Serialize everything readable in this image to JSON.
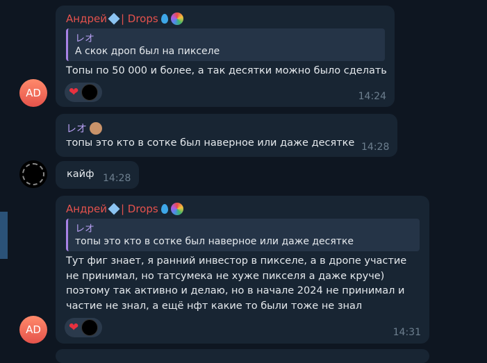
{
  "messages": [
    {
      "sender": "Андрей",
      "sender_suffix": "| Drops",
      "reply_name": "レオ",
      "reply_text": "А скок дроп был на пикселе",
      "text": "Топы по 50 000 и более, а так десятки можно было сделать",
      "time": "14:24",
      "avatar": "AD",
      "reaction": "❤"
    },
    {
      "sender": "レオ",
      "text": "топы это кто в сотке был наверное или даже десятке",
      "time": "14:28"
    },
    {
      "text": "кайф",
      "time": "14:28"
    },
    {
      "sender": "Андрей",
      "sender_suffix": "| Drops",
      "reply_name": "レオ",
      "reply_text": "топы это кто в сотке был наверное или даже десятке",
      "text": "Тут фиг знает, я ранний инвестор в пикселе, а в дропе участие\nне принимал, но татсумека не хуже пикселя а даже круче)\nпоэтому так активно и делаю, но в начале 2024 не принимал и\nчастие не знал, а ещё нфт какие то были тоже не знал",
      "time": "14:31",
      "avatar": "AD",
      "reaction": "❤"
    }
  ],
  "colors": {
    "background": "#0e1621",
    "bubble": "#182533",
    "sender": "#e5524d",
    "reply_accent": "#a882e6"
  }
}
